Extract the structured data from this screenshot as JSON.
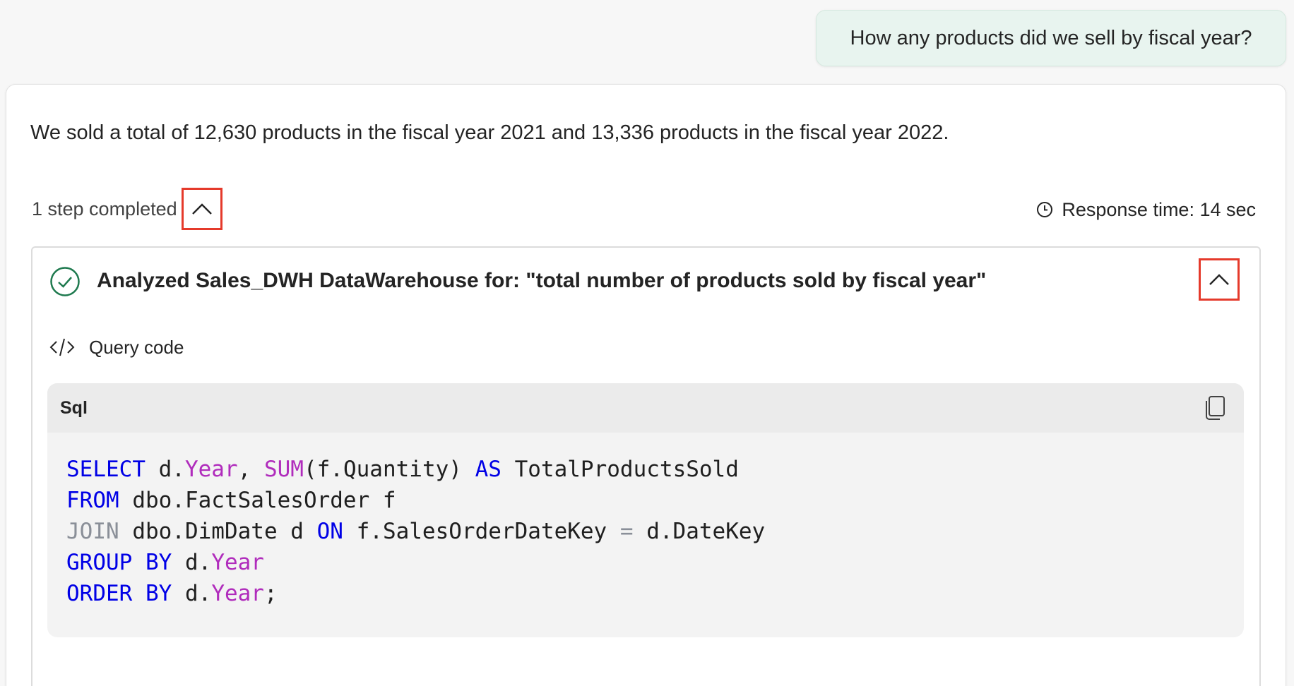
{
  "user_message": "How any products did we sell by fiscal year?",
  "answer": "We sold a total of 12,630 products in the fiscal year 2021 and 13,336 products in the fiscal year 2022.",
  "steps": {
    "status_text": "1 step completed",
    "response_time": "Response time: 14 sec"
  },
  "step": {
    "title": "Analyzed Sales_DWH DataWarehouse for: \"total number of products sold by fiscal year\"",
    "query_label": "Query code",
    "code_language": "Sql",
    "code_lines": [
      [
        {
          "t": "SELECT",
          "c": "kw"
        },
        {
          "t": " d."
        },
        {
          "t": "Year",
          "c": "fn"
        },
        {
          "t": ", "
        },
        {
          "t": "SUM",
          "c": "fn"
        },
        {
          "t": "(f.Quantity) "
        },
        {
          "t": "AS",
          "c": "kw"
        },
        {
          "t": " TotalProductsSold"
        }
      ],
      [
        {
          "t": "FROM",
          "c": "kw"
        },
        {
          "t": " dbo.FactSalesOrder f"
        }
      ],
      [
        {
          "t": "JOIN",
          "c": "dim"
        },
        {
          "t": " dbo.DimDate d "
        },
        {
          "t": "ON",
          "c": "kw"
        },
        {
          "t": " f.SalesOrderDateKey "
        },
        {
          "t": "=",
          "c": "dim"
        },
        {
          "t": " d.DateKey"
        }
      ],
      [
        {
          "t": "GROUP BY",
          "c": "kw"
        },
        {
          "t": " d."
        },
        {
          "t": "Year",
          "c": "fn"
        }
      ],
      [
        {
          "t": "ORDER BY",
          "c": "kw"
        },
        {
          "t": " d."
        },
        {
          "t": "Year",
          "c": "fn"
        },
        {
          "t": ";"
        }
      ]
    ]
  },
  "icons": {
    "collapse": "chevron-up-icon",
    "clock": "clock-icon",
    "check": "check-circle-icon",
    "code": "code-icon",
    "copy": "copy-icon"
  },
  "colors": {
    "highlight_border": "#e53a2b",
    "user_bubble": "#e8f4ef",
    "check_green": "#1f7a4f",
    "sql_keyword": "#0000e6",
    "sql_function": "#b02cbc"
  }
}
